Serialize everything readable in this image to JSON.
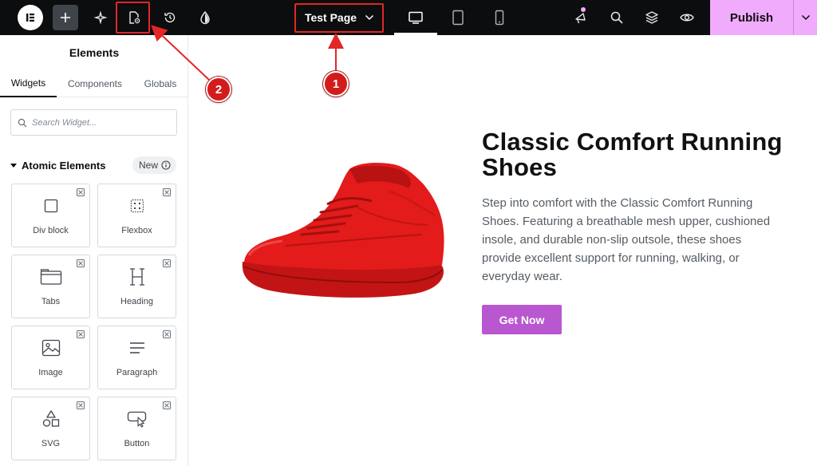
{
  "topbar": {
    "page_name": "Test Page",
    "publish_label": "Publish",
    "icons": [
      "elementor-logo-icon",
      "add-plus-icon",
      "ai-sparkle-icon",
      "page-settings-icon",
      "history-icon",
      "site-settings-icon",
      "desktop-icon",
      "tablet-icon",
      "mobile-icon",
      "whats-new-icon",
      "search-icon",
      "structure-layers-icon",
      "preview-eye-icon",
      "chevron-down-icon"
    ],
    "active_device": "desktop"
  },
  "annotations": {
    "badge1": "1",
    "badge2": "2",
    "color": "#e32626"
  },
  "sidebar": {
    "title": "Elements",
    "tabs": [
      {
        "label": "Widgets",
        "active": true
      },
      {
        "label": "Components",
        "active": false
      },
      {
        "label": "Globals",
        "active": false
      }
    ],
    "search": {
      "placeholder": "Search Widget..."
    },
    "section": {
      "label": "Atomic Elements",
      "badge": "New"
    },
    "widgets": [
      {
        "label": "Div block",
        "icon": "div-block-icon"
      },
      {
        "label": "Flexbox",
        "icon": "flexbox-icon"
      },
      {
        "label": "Tabs",
        "icon": "tabs-icon"
      },
      {
        "label": "Heading",
        "icon": "heading-icon"
      },
      {
        "label": "Image",
        "icon": "image-icon"
      },
      {
        "label": "Paragraph",
        "icon": "paragraph-icon"
      },
      {
        "label": "SVG",
        "icon": "svg-shapes-icon"
      },
      {
        "label": "Button",
        "icon": "button-cursor-icon"
      }
    ]
  },
  "canvas": {
    "title": "Classic Comfort Running Shoes",
    "description": "Step into comfort with the Classic Comfort Running Shoes. Featuring a breathable mesh upper, cushioned insole, and durable non-slip outsole, these shoes provide excellent support for running, walking, or everyday wear.",
    "cta_label": "Get Now",
    "cta_color": "#b857d0",
    "shoe_color": "#e31b1b"
  },
  "colors": {
    "topbar_bg": "#0c0d0e",
    "publish_bg": "#f0abfc"
  }
}
